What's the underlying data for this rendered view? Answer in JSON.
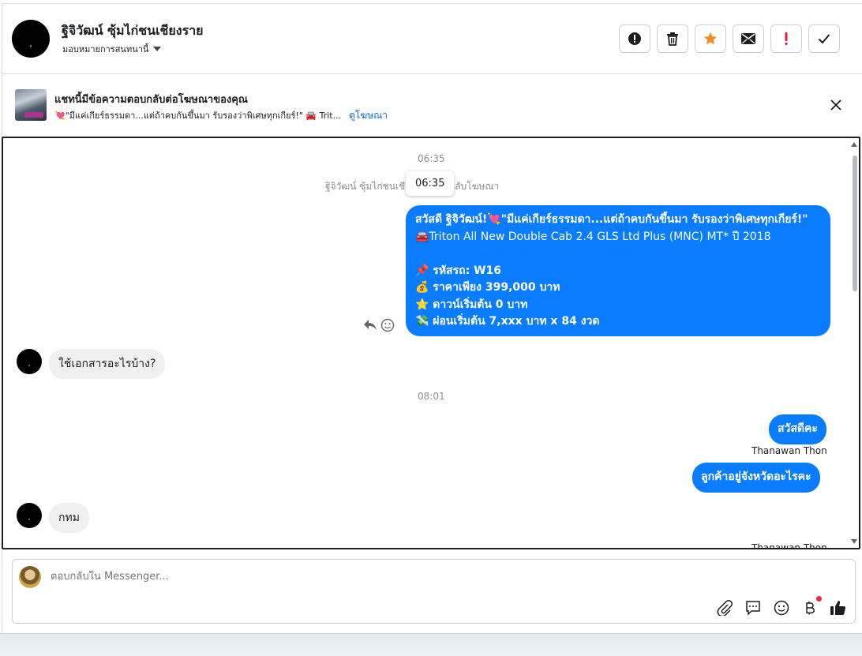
{
  "header": {
    "contact_name": "ฐิจิวัฒน์ ซุ้มไก่ชนเชียงราย",
    "assign_label": "มอบหมายการสนทนานี้",
    "actions": [
      "report-icon",
      "trash-icon",
      "star-icon",
      "mail-icon",
      "important-icon",
      "check-icon"
    ],
    "accent_color": "#f38b1f"
  },
  "banner": {
    "title": "แชทนี้มีข้อความตอบกลับต่อโฆษณาของคุณ",
    "subtitle": "💘\"มีแค่เกียร์ธรรมดา...แต่ถ้าคบกันขึ้นมา รับรองว่าพิเศษทุกเกียร์!\" 🚘 Trit...",
    "link": "ดูโฆษณา"
  },
  "chat": {
    "time1": "06:35",
    "system_text": "ฐิจิวัฒน์ ซุ้มไก่ชนเชียงรายตอบกลับโฆษณา",
    "tooltip": "06:35",
    "ad_message": [
      "สวัสดี ฐิจิวัฒน์!💘\"มีแค่เกียร์ธรรมดา...แต่ถ้าคบกันขึ้นมา รับรองว่าพิเศษทุกเกียร์!\"",
      "🚘Triton All New Double Cab 2.4 GLS Ltd Plus (MNC) MT* ปี 2018",
      "",
      "📌 รหัสรถ: W16",
      "💰 ราคาเพียง 399,000 บาท",
      "⭐ ดาวน์เริ่มต้น 0 บาท",
      "💸 ผ่อนเริ่มต้น 7,xxx บาท x 84 งวด"
    ],
    "incoming1": "ใช้เอกสารอะไรบ้าง?",
    "time2": "08:01",
    "outgoing1": "สวัสดีคะ",
    "sender1": "Thanawan Thon",
    "outgoing2": "ลูกค้าอยู่จังหวัดอะไรคะ",
    "incoming2": "กทม",
    "sender2": "Thanawan Thon"
  },
  "composer": {
    "placeholder": "ตอบกลับใน Messenger...",
    "tools": [
      "attach-icon",
      "saved-reply-icon",
      "emoji-icon",
      "baht-icon",
      "thumbs-up-icon"
    ],
    "primary_color": "#0a7cff"
  }
}
